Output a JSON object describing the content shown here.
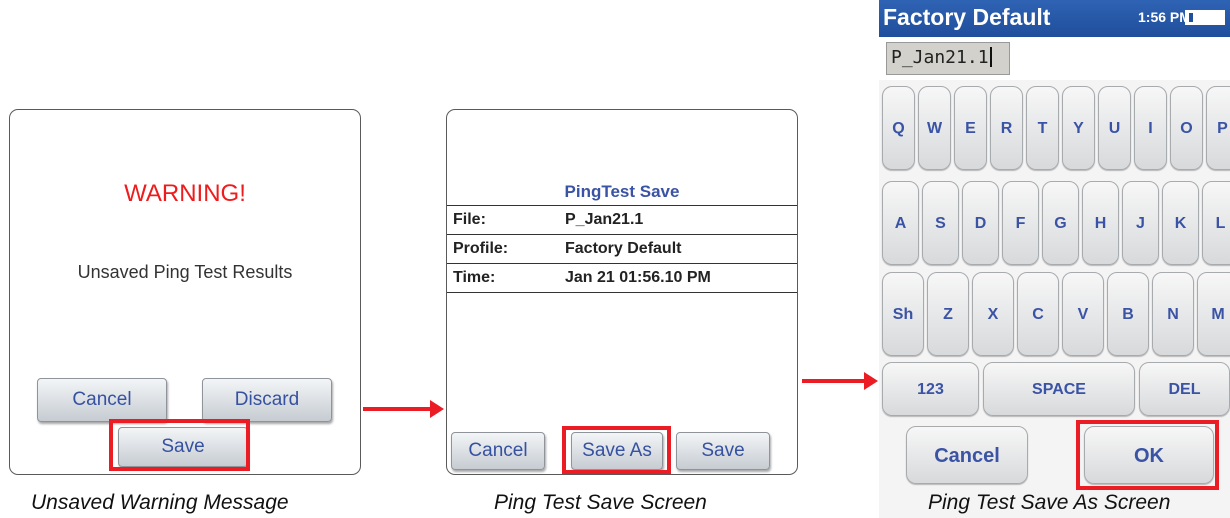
{
  "warning_panel": {
    "title": "WARNING!",
    "message": "Unsaved Ping Test Results",
    "cancel_label": "Cancel",
    "discard_label": "Discard",
    "save_label": "Save",
    "caption": "Unsaved Warning Message"
  },
  "save_panel": {
    "title": "PingTest Save",
    "fields": [
      {
        "label": "File:",
        "value": "P_Jan21.1"
      },
      {
        "label": "Profile:",
        "value": "Factory Default"
      },
      {
        "label": "Time:",
        "value": "Jan 21 01:56.10 PM"
      }
    ],
    "cancel_label": "Cancel",
    "save_as_label": "Save As",
    "save_label": "Save",
    "caption": "Ping Test Save Screen"
  },
  "keyboard_panel": {
    "header_title": "Factory Default",
    "time": "1:56 PM",
    "input_value": "P_Jan21.1",
    "row1": [
      "Q",
      "W",
      "E",
      "R",
      "T",
      "Y",
      "U",
      "I",
      "O",
      "P"
    ],
    "row2": [
      "A",
      "S",
      "D",
      "F",
      "G",
      "H",
      "J",
      "K",
      "L"
    ],
    "row3": [
      "Sh",
      "Z",
      "X",
      "C",
      "V",
      "B",
      "N",
      "M"
    ],
    "num_label": "123",
    "space_label": "SPACE",
    "del_label": "DEL",
    "cancel_label": "Cancel",
    "ok_label": "OK",
    "caption": "Ping Test Save As Screen"
  },
  "colors": {
    "highlight": "#ec1c24",
    "warning_text": "#ee1c1c",
    "button_text": "#3551a0",
    "header_bg": "#1f4e9c"
  }
}
